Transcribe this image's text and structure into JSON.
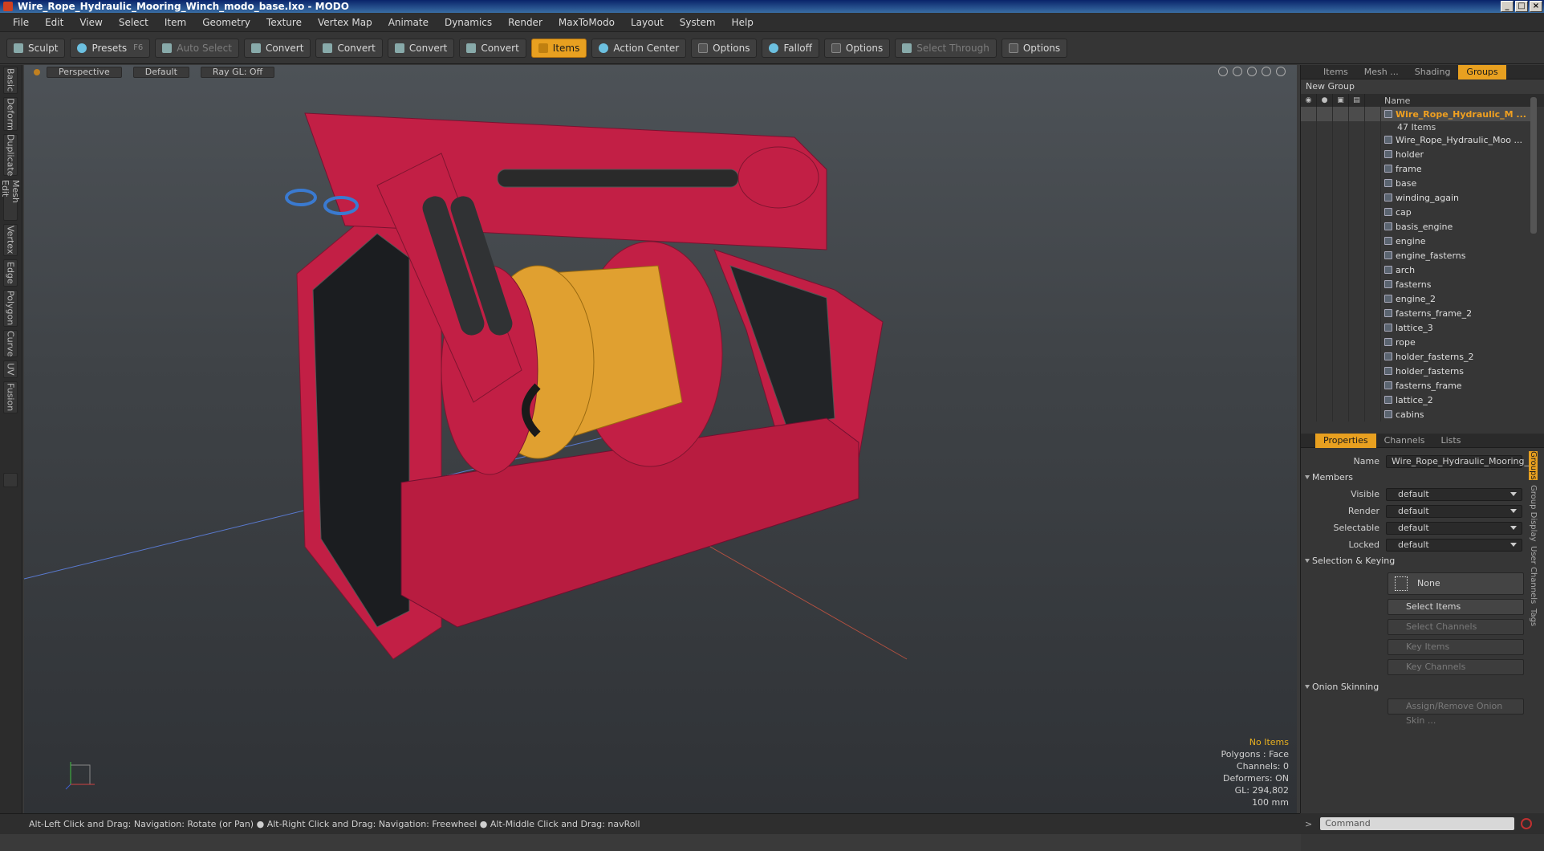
{
  "window": {
    "title": "Wire_Rope_Hydraulic_Mooring_Winch_modo_base.lxo - MODO"
  },
  "menu": [
    "File",
    "Edit",
    "View",
    "Select",
    "Item",
    "Geometry",
    "Texture",
    "Vertex Map",
    "Animate",
    "Dynamics",
    "Render",
    "MaxToModo",
    "Layout",
    "System",
    "Help"
  ],
  "toolbar": {
    "sculpt": "Sculpt",
    "presets": "Presets",
    "presets_key": "F6",
    "auto_select": "Auto Select",
    "convert1": "Convert",
    "convert2": "Convert",
    "convert3": "Convert",
    "convert4": "Convert",
    "items": "Items",
    "action_center": "Action Center",
    "options1": "Options",
    "falloff": "Falloff",
    "options2": "Options",
    "select_through": "Select Through",
    "options3": "Options"
  },
  "left_tabs": [
    "Basic",
    "Deform",
    "Duplicate",
    "Mesh Edit",
    "Vertex",
    "Edge",
    "Polygon",
    "Curve",
    "UV",
    "Fusion"
  ],
  "viewport": {
    "view": "Perspective",
    "shading": "Default",
    "raygl": "Ray GL: Off",
    "stats": {
      "no_items": "No Items",
      "polygons": "Polygons : Face",
      "channels": "Channels: 0",
      "deformers": "Deformers: ON",
      "gl": "GL: 294,802",
      "scale": "100 mm"
    }
  },
  "status": "Alt-Left Click and Drag: Navigation: Rotate (or Pan) ●  Alt-Right Click and Drag: Navigation: Freewheel ●  Alt-Middle Click and Drag: navRoll",
  "panel": {
    "tabs": [
      "Items",
      "Mesh ...",
      "Shading",
      "Groups"
    ],
    "new_group": "New Group",
    "name_col": "Name",
    "group_name": "Wire_Rope_Hydraulic_M ...",
    "group_count": "47 Items",
    "items": [
      "Wire_Rope_Hydraulic_Moo ...",
      "holder",
      "frame",
      "base",
      "winding_again",
      "cap",
      "basis_engine",
      "engine",
      "engine_fasterns",
      "arch",
      "fasterns",
      "engine_2",
      "fasterns_frame_2",
      "lattice_3",
      "rope",
      "holder_fasterns_2",
      "holder_fasterns",
      "fasterns_frame",
      "lattice_2",
      "cabins"
    ]
  },
  "props": {
    "tabs": [
      "Properties",
      "Channels",
      "Lists"
    ],
    "name_label": "Name",
    "name_value": "Wire_Rope_Hydraulic_Mooring_V",
    "members": "Members",
    "visible_label": "Visible",
    "visible_value": "default",
    "render_label": "Render",
    "render_value": "default",
    "selectable_label": "Selectable",
    "selectable_value": "default",
    "locked_label": "Locked",
    "locked_value": "default",
    "sel_keying": "Selection & Keying",
    "none": "None",
    "select_items": "Select Items",
    "select_channels": "Select Channels",
    "key_items": "Key Items",
    "key_channels": "Key Channels",
    "onion": "Onion Skinning",
    "assign_onion": "Assign/Remove Onion Skin ...",
    "side_tabs": [
      "Groups",
      "Group Display",
      "User Channels",
      "Tags"
    ]
  },
  "command": {
    "placeholder": "Command"
  }
}
